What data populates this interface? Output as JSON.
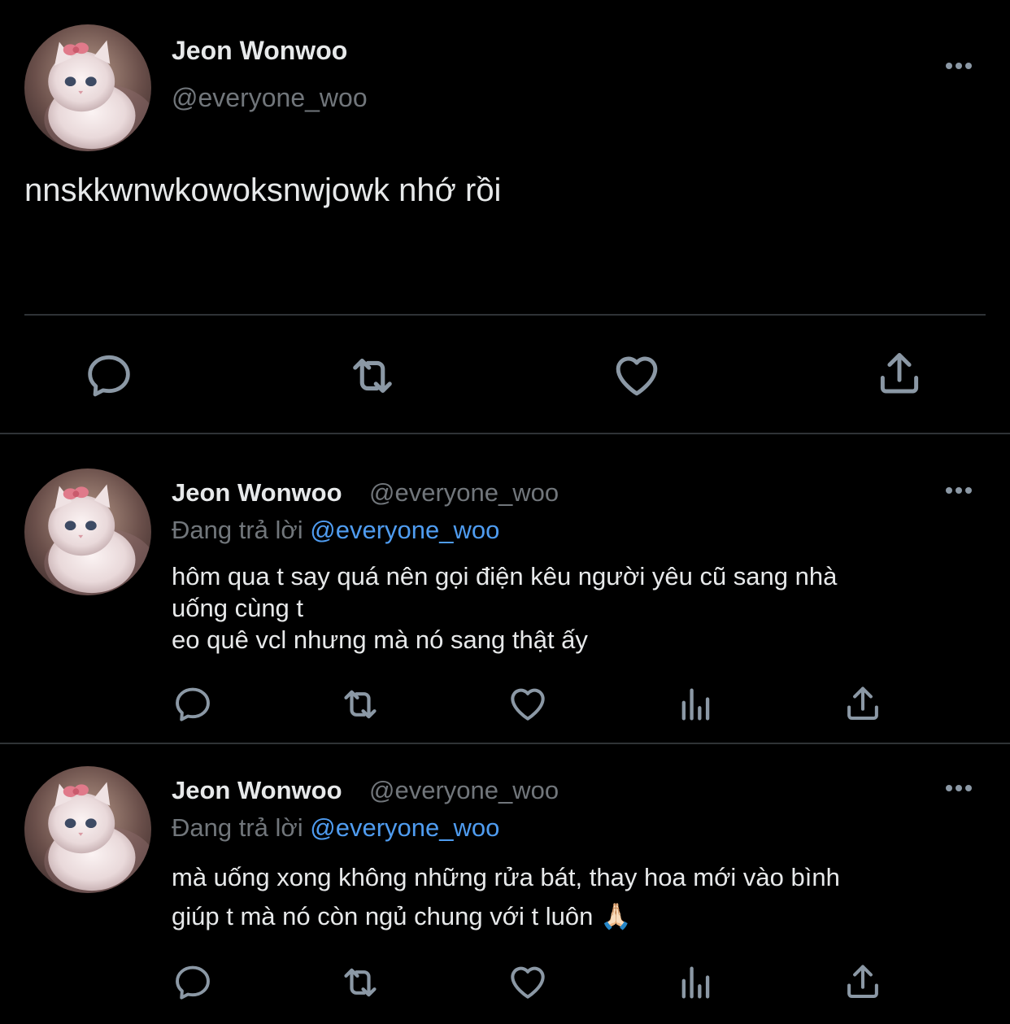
{
  "main_tweet": {
    "name": "Jeon Wonwoo",
    "handle": "@everyone_woo",
    "text": "nnskkwnwkowoksnwjowk nhớ rồi",
    "more_icon": "more-horizontal-icon",
    "actions": [
      "comment-icon",
      "retweet-icon",
      "like-icon",
      "share-icon"
    ]
  },
  "replies": [
    {
      "name": "Jeon Wonwoo",
      "handle": "@everyone_woo",
      "replying_prefix": "Đang trả lời",
      "replying_to": "@everyone_woo",
      "text": "hôm qua t say quá nên gọi điện kêu người yêu cũ sang nhà\nuống cùng t\neo quê vcl nhưng mà nó sang thật ấy",
      "actions": [
        "comment-icon",
        "retweet-icon",
        "like-icon",
        "analytics-icon",
        "share-icon"
      ]
    },
    {
      "name": "Jeon Wonwoo",
      "handle": "@everyone_woo",
      "replying_prefix": "Đang trả lời",
      "replying_to": "@everyone_woo",
      "text": "mà uống xong không những rửa bát, thay hoa mới vào bình\ngiúp t mà nó còn ngủ chung với t luôn 🙏🏻",
      "actions": [
        "comment-icon",
        "retweet-icon",
        "like-icon",
        "analytics-icon",
        "share-icon"
      ]
    }
  ],
  "colors": {
    "background": "#000000",
    "text": "#e7e9ea",
    "secondary": "#71767b",
    "mention": "#4f9cf0",
    "icon": "#8b98a5",
    "divider": "#2f3336"
  }
}
